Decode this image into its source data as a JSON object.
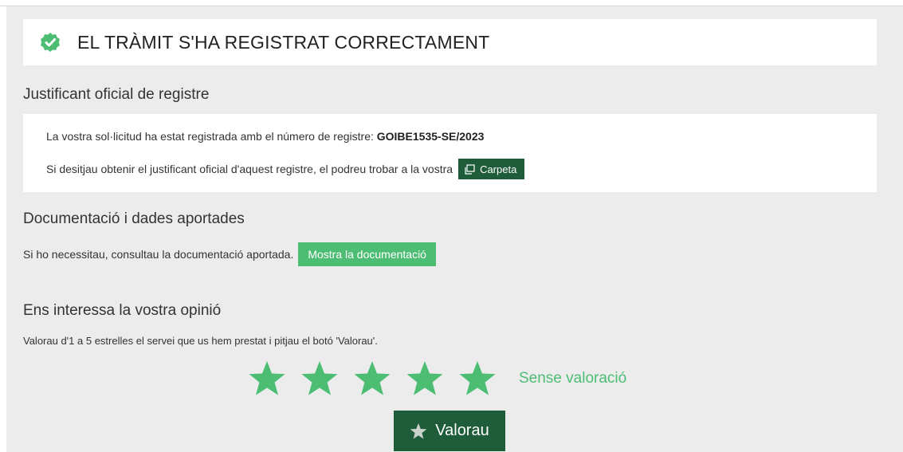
{
  "success": {
    "title": "EL TRÀMIT S'HA REGISTRAT CORRECTAMENT",
    "icon": "check-circle-icon"
  },
  "registry": {
    "heading": "Justificant oficial de registre",
    "line1_prefix": "La vostra sol·licitud ha estat registrada amb el número de registre:",
    "registration_number": "GOIBE1535-SE/2023",
    "line2_prefix": "Si desitjau obtenir el justificant oficial d'aquest registre, el podreu trobar a la vostra",
    "carpeta_label": "Carpeta",
    "carpeta_icon": "folder-icon"
  },
  "documents": {
    "heading": "Documentació i dades aportades",
    "text": "Si ho necessitau, consultau la documentació aportada.",
    "button_label": "Mostra la documentació"
  },
  "opinion": {
    "heading": "Ens interessa la vostra opinió",
    "instructions": "Valorau d'1 a 5 estrelles el servei que us hem prestat i pitjau el botó 'Valorau'.",
    "stars_total": 5,
    "rating_status": "Sense valoració",
    "submit_label": "Valorau",
    "submit_icon": "star-icon"
  },
  "colors": {
    "dark_green": "#1e5c3a",
    "light_green": "#4dbd74",
    "panel_gray": "#ececec"
  }
}
